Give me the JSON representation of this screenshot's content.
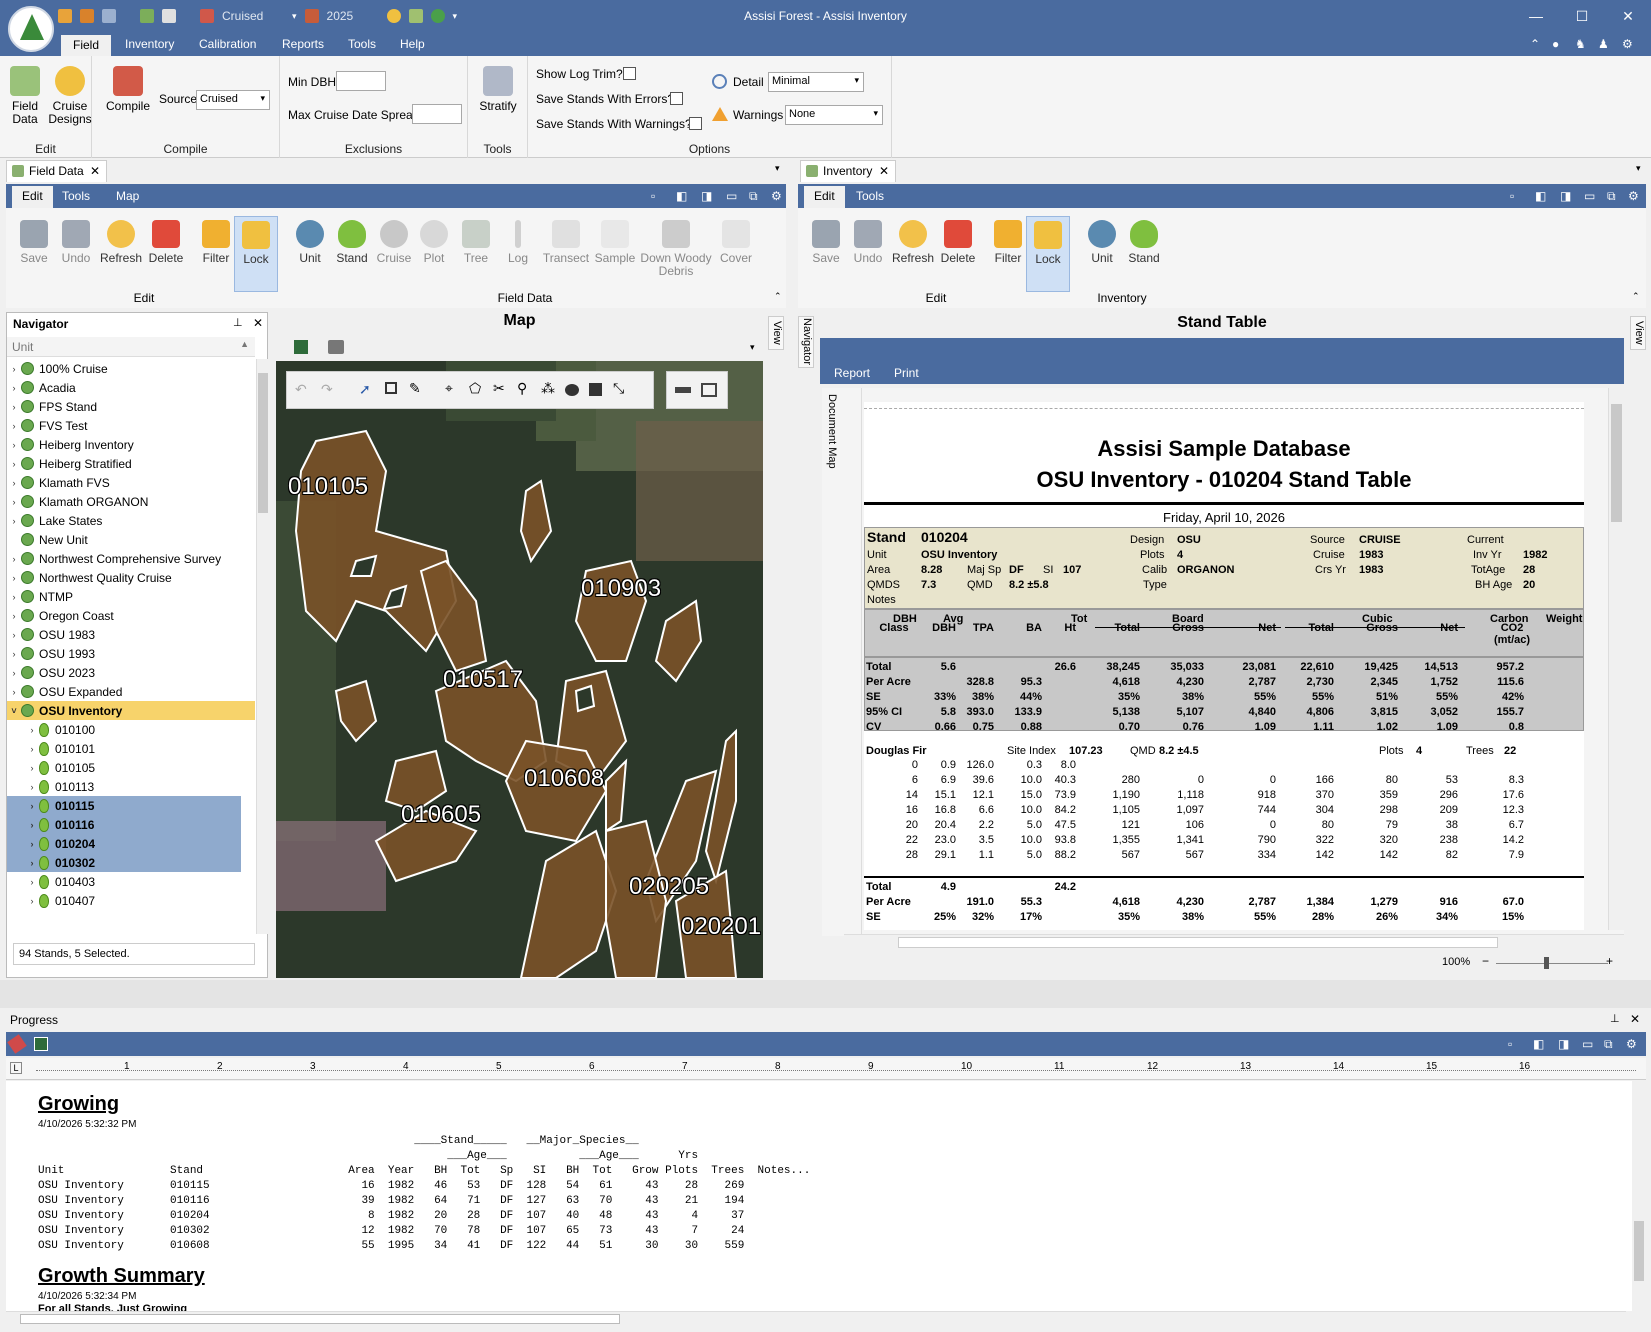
{
  "app": {
    "window_title": "Assisi Forest - Assisi Inventory",
    "quick_access": {
      "source_value": "Cruised",
      "year_value": "2025"
    },
    "menu_tabs": [
      "Field",
      "Inventory",
      "Calibration",
      "Reports",
      "Tools",
      "Help"
    ],
    "active_menu": "Field"
  },
  "ribbon": {
    "edit_group": {
      "label": "Edit",
      "field_data": "Field\nData",
      "cruise_designs": "Cruise\nDesigns"
    },
    "compile_group": {
      "label": "Compile",
      "compile": "Compile",
      "source_label": "Source",
      "source_value": "Cruised"
    },
    "exclusions_group": {
      "label": "Exclusions",
      "min_dbh": "Min DBH",
      "max_spread": "Max Cruise Date Spread"
    },
    "tools_group": {
      "label": "Tools",
      "stratify": "Stratify"
    },
    "options_group": {
      "label": "Options",
      "show_log_trim": "Show Log Trim?",
      "save_errors": "Save Stands With Errors?",
      "save_warnings": "Save Stands With Warnings?",
      "detail_label": "Detail",
      "detail_value": "Minimal",
      "warnings_label": "Warnings",
      "warnings_value": "None"
    }
  },
  "field_data_panel": {
    "tab_title": "Field Data",
    "tabs": [
      "Edit",
      "Tools",
      "Map"
    ],
    "edit_buttons": [
      "Save",
      "Undo",
      "Refresh",
      "Delete",
      "Filter",
      "Lock"
    ],
    "field_buttons": [
      "Unit",
      "Stand",
      "Cruise",
      "Plot",
      "Tree",
      "Log",
      "Transect",
      "Sample",
      "Down Woody Debris",
      "Cover"
    ],
    "edit_group_label": "Edit",
    "field_group_label": "Field Data"
  },
  "inventory_panel": {
    "tab_title": "Inventory",
    "tabs": [
      "Edit",
      "Tools"
    ],
    "edit_buttons": [
      "Save",
      "Undo",
      "Refresh",
      "Delete",
      "Filter",
      "Lock"
    ],
    "inv_buttons": [
      "Unit",
      "Stand"
    ],
    "edit_group_label": "Edit",
    "inv_group_label": "Inventory"
  },
  "navigator": {
    "title": "Navigator",
    "column": "Unit",
    "items": [
      "100% Cruise",
      "Acadia",
      "FPS Stand",
      "FVS Test",
      "Heiberg Inventory",
      "Heiberg Stratified",
      "Klamath FVS",
      "Klamath ORGANON",
      "Lake States",
      "New Unit",
      "Northwest Comprehensive Survey",
      "Northwest Quality Cruise",
      "NTMP",
      "Oregon Coast",
      "OSU 1983",
      "OSU 1993",
      "OSU 2023",
      "OSU Expanded",
      "OSU Inventory"
    ],
    "stands": [
      "010100",
      "010101",
      "010105",
      "010113",
      "010115",
      "010116",
      "010204",
      "010302",
      "010403",
      "010407"
    ],
    "selected_stands": [
      "010115",
      "010116",
      "010204",
      "010302"
    ],
    "status": "94 Stands, 5 Selected."
  },
  "map": {
    "title": "Map",
    "side_tab": "View",
    "labels": [
      "010105",
      "010903",
      "010517",
      "010608",
      "010605",
      "020205",
      "020201"
    ]
  },
  "stand_table": {
    "title": "Stand Table",
    "side_tab_left": "Navigator",
    "side_tab_right": "View",
    "toolbar": [
      "Report",
      "Print"
    ],
    "document_map": "Document Map",
    "report_title_1": "Assisi Sample Database",
    "report_title_2": "OSU Inventory - 010204 Stand Table",
    "date": "Friday, April 10, 2026",
    "zoom": "100%",
    "header": {
      "stand_label": "Stand",
      "stand": "010204",
      "unit_label": "Unit",
      "unit": "OSU Inventory",
      "area_label": "Area",
      "area": "8.28",
      "majsp_label": "Maj Sp",
      "majsp": "DF",
      "si_label": "SI",
      "si": "107",
      "qmds_label": "QMDS",
      "qmds": "7.3",
      "qmd_label": "QMD",
      "qmd": "8.2 ±5.8",
      "notes_label": "Notes",
      "design_label": "Design",
      "design": "OSU",
      "plots_label": "Plots",
      "plots": "4",
      "calib_label": "Calib",
      "calib": "ORGANON",
      "type_label": "Type",
      "source_label": "Source",
      "source": "CRUISE",
      "cruise_label": "Cruise",
      "cruise": "1983",
      "crsyr_label": "Crs Yr",
      "crsyr": "1983",
      "current_label": "Current",
      "invyr_label": "Inv Yr",
      "invyr": "1982",
      "totage_label": "TotAge",
      "totage": "28",
      "bhage_label": "BH Age",
      "bhage": "20"
    },
    "col_groups": [
      "DBH",
      "Avg",
      "Tot",
      "Board",
      "Cubic",
      "Carbon",
      "Weight"
    ],
    "columns": [
      "Class",
      "DBH",
      "TPA",
      "BA",
      "Ht",
      "Total",
      "Gross",
      "Net",
      "Total",
      "Gross",
      "Net",
      "CO2\n(mt/ac)"
    ],
    "summary_rows": [
      [
        "Total",
        "5.6",
        "",
        "",
        "26.6",
        "38,245",
        "35,033",
        "23,081",
        "22,610",
        "19,425",
        "14,513",
        "957.2"
      ],
      [
        "Per Acre",
        "",
        "328.8",
        "95.3",
        "",
        "4,618",
        "4,230",
        "2,787",
        "2,730",
        "2,345",
        "1,752",
        "115.6"
      ],
      [
        "SE",
        "33%",
        "38%",
        "44%",
        "",
        "35%",
        "38%",
        "55%",
        "55%",
        "51%",
        "55%",
        "42%"
      ],
      [
        "95% CI",
        "5.8",
        "393.0",
        "133.9",
        "",
        "5,138",
        "5,107",
        "4,840",
        "4,806",
        "3,815",
        "3,052",
        "155.7"
      ],
      [
        "CV",
        "0.66",
        "0.75",
        "0.88",
        "",
        "0.70",
        "0.76",
        "1.09",
        "1.11",
        "1.02",
        "1.09",
        "0.8"
      ]
    ],
    "species": {
      "name": "Douglas Fir",
      "si_label": "Site Index",
      "si": "107.23",
      "qmd_label": "QMD",
      "qmd": "8.2 ±4.5",
      "plots_label": "Plots",
      "plots": "4",
      "trees_label": "Trees",
      "trees": "22"
    },
    "species_rows": [
      [
        "0",
        "0.9",
        "126.0",
        "0.3",
        "8.0",
        "",
        "",
        "",
        "",
        "",
        "",
        ""
      ],
      [
        "6",
        "6.9",
        "39.6",
        "10.0",
        "40.3",
        "280",
        "0",
        "0",
        "166",
        "80",
        "53",
        "8.3"
      ],
      [
        "14",
        "15.1",
        "12.1",
        "15.0",
        "73.9",
        "1,190",
        "1,118",
        "918",
        "370",
        "359",
        "296",
        "17.6"
      ],
      [
        "16",
        "16.8",
        "6.6",
        "10.0",
        "84.2",
        "1,105",
        "1,097",
        "744",
        "304",
        "298",
        "209",
        "12.3"
      ],
      [
        "20",
        "20.4",
        "2.2",
        "5.0",
        "47.5",
        "121",
        "106",
        "0",
        "80",
        "79",
        "38",
        "6.7"
      ],
      [
        "22",
        "23.0",
        "3.5",
        "10.0",
        "93.8",
        "1,355",
        "1,341",
        "790",
        "322",
        "320",
        "238",
        "14.2"
      ],
      [
        "28",
        "29.1",
        "1.1",
        "5.0",
        "88.2",
        "567",
        "567",
        "334",
        "142",
        "142",
        "82",
        "7.9"
      ]
    ],
    "species_summary": [
      [
        "Total",
        "4.9",
        "",
        "",
        "24.2",
        "",
        "",
        "",
        "",
        "",
        "",
        ""
      ],
      [
        "Per Acre",
        "",
        "191.0",
        "55.3",
        "",
        "4,618",
        "4,230",
        "2,787",
        "1,384",
        "1,279",
        "916",
        "67.0"
      ],
      [
        "SE",
        "25%",
        "32%",
        "17%",
        "",
        "35%",
        "38%",
        "55%",
        "28%",
        "26%",
        "34%",
        "15%"
      ]
    ]
  },
  "progress": {
    "title": "Progress",
    "ruler": [
      "1",
      "2",
      "3",
      "4",
      "5",
      "6",
      "7",
      "8",
      "9",
      "10",
      "11",
      "12",
      "13",
      "14",
      "15",
      "16"
    ],
    "section1_title": "Growing",
    "section1_time": "4/10/2026 5:32:32 PM",
    "hdr_line1": "                                                         ____Stand_____   __Major_Species__",
    "hdr_line2": "                                                              ___Age___           ___Age___      Yrs",
    "hdr_line3": "Unit                Stand                      Area  Year   BH  Tot   Sp   SI   BH  Tot   Grow Plots  Trees  Notes...",
    "rows": [
      "OSU Inventory       010115                       16  1982   46   53   DF  128   54   61     43    28    269",
      "OSU Inventory       010116                       39  1982   64   71   DF  127   63   70     43    21    194",
      "OSU Inventory       010204                        8  1982   20   28   DF  107   40   48     43     4     37",
      "OSU Inventory       010302                       12  1982   70   78   DF  107   65   73     43     7     24",
      "OSU Inventory       010608                       55  1995   34   41   DF  122   44   51     30    30    559"
    ],
    "section2_title": "Growth Summary",
    "section2_time": "4/10/2026 5:32:34 PM",
    "section2_sub": "For all Stands, Just Growing"
  }
}
